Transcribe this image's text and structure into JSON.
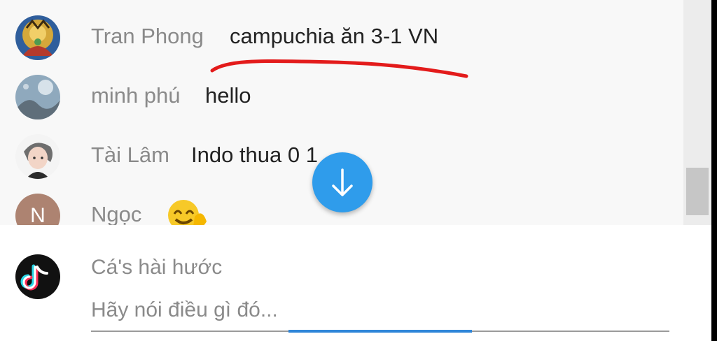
{
  "messages": [
    {
      "name": "Tran Phong",
      "text": "campuchia ăn 3-1 VN",
      "avatar": "gold-ornament-avatar"
    },
    {
      "name": "minh phú",
      "text": "hello",
      "avatar": "blue-gray-photo-avatar"
    },
    {
      "name": "Tài Lâm",
      "text": "Indo thua 0 1",
      "avatar": "anime-boy-avatar"
    },
    {
      "name": "Ngọc",
      "text": "",
      "avatar_initial": "N",
      "emoji": "smiling-face-emoji"
    }
  ],
  "composer": {
    "name": "Cá's hài hước",
    "placeholder": "Hãy nói điều gì đó...",
    "avatar": "tiktok-logo-avatar"
  },
  "icons": {
    "scroll_down": "arrow-down-icon"
  },
  "colors": {
    "accent": "#2f9ceb",
    "annotation": "#e31b1b"
  }
}
